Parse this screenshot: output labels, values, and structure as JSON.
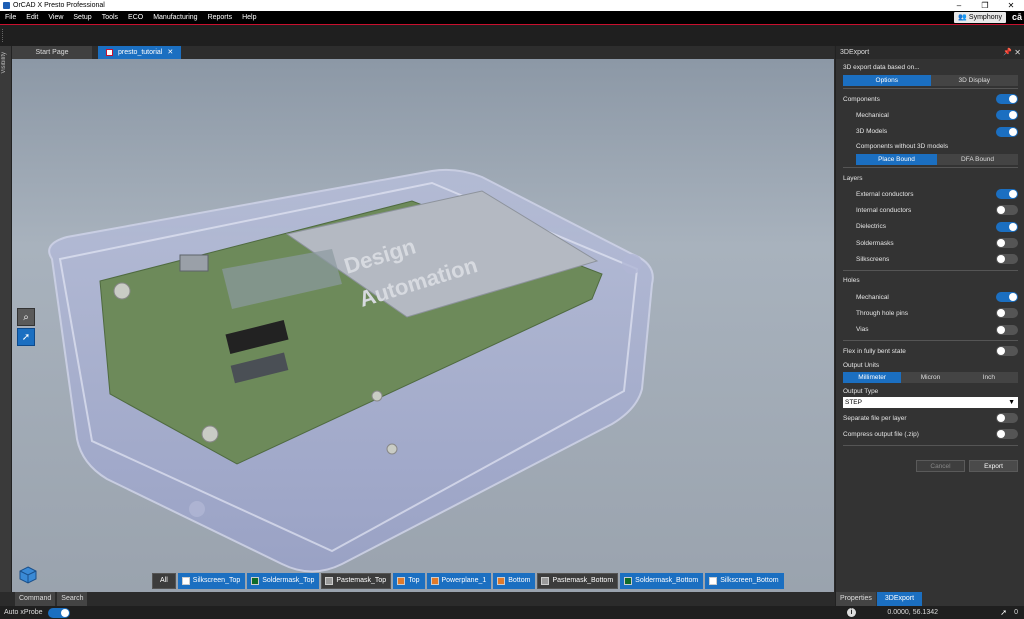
{
  "app": {
    "title": "OrCAD X Presto Professional"
  },
  "menu": [
    "File",
    "Edit",
    "View",
    "Setup",
    "Tools",
    "ECO",
    "Manufacturing",
    "Reports",
    "Help"
  ],
  "symphony_label": "Symphony",
  "left_strip_label": "Visibility",
  "tabs": {
    "start": "Start Page",
    "active": "presto_tutorial",
    "close": "✕"
  },
  "viewport": {
    "board_text_1": "Design",
    "board_text_2": "Automation"
  },
  "layers": {
    "all": "All",
    "items": [
      {
        "label": "Silkscreen_Top",
        "color": "#ffffff",
        "active": true
      },
      {
        "label": "Soldermask_Top",
        "color": "#0e6b2a",
        "active": true
      },
      {
        "label": "Pastemask_Top",
        "color": "#9a9a9a",
        "active": false
      },
      {
        "label": "Top",
        "color": "#e07a2a",
        "active": true
      },
      {
        "label": "Powerplane_1",
        "color": "#e07a2a",
        "active": true
      },
      {
        "label": "Bottom",
        "color": "#e07a2a",
        "active": true
      },
      {
        "label": "Pastemask_Bottom",
        "color": "#9a9a9a",
        "active": false
      },
      {
        "label": "Soldermask_Bottom",
        "color": "#0e6b2a",
        "active": true
      },
      {
        "label": "Silkscreen_Bottom",
        "color": "#ffffff",
        "active": true
      }
    ]
  },
  "bottom_tabs": [
    "Command",
    "Search"
  ],
  "status": {
    "auto_xprobe": "Auto xProbe",
    "coords": "0.0000, 56.1342",
    "count": "0"
  },
  "panel": {
    "title": "3DExport",
    "based_on": "3D export data based on...",
    "based_options": [
      "Options",
      "3D Display"
    ],
    "components": "Components",
    "mechanical": "Mechanical",
    "models_3d": "3D Models",
    "without_models": "Components without 3D models",
    "bound_options": [
      "Place Bound",
      "DFA Bound"
    ],
    "layers": "Layers",
    "external": "External conductors",
    "internal": "Internal conductors",
    "dielectrics": "Dielectrics",
    "soldermasks": "Soldermasks",
    "silkscreens": "Silkscreens",
    "holes": "Holes",
    "holes_mechanical": "Mechanical",
    "through_hole": "Through hole pins",
    "vias": "Vias",
    "flex": "Flex in fully bent state",
    "output_units": "Output Units",
    "units": [
      "Millimeter",
      "Micron",
      "Inch"
    ],
    "output_type": "Output Type",
    "type_value": "STEP",
    "separate": "Separate file per layer",
    "compress": "Compress output file (.zip)",
    "cancel": "Cancel",
    "export": "Export",
    "bottom_tabs": [
      "Properties",
      "3DExport"
    ]
  }
}
